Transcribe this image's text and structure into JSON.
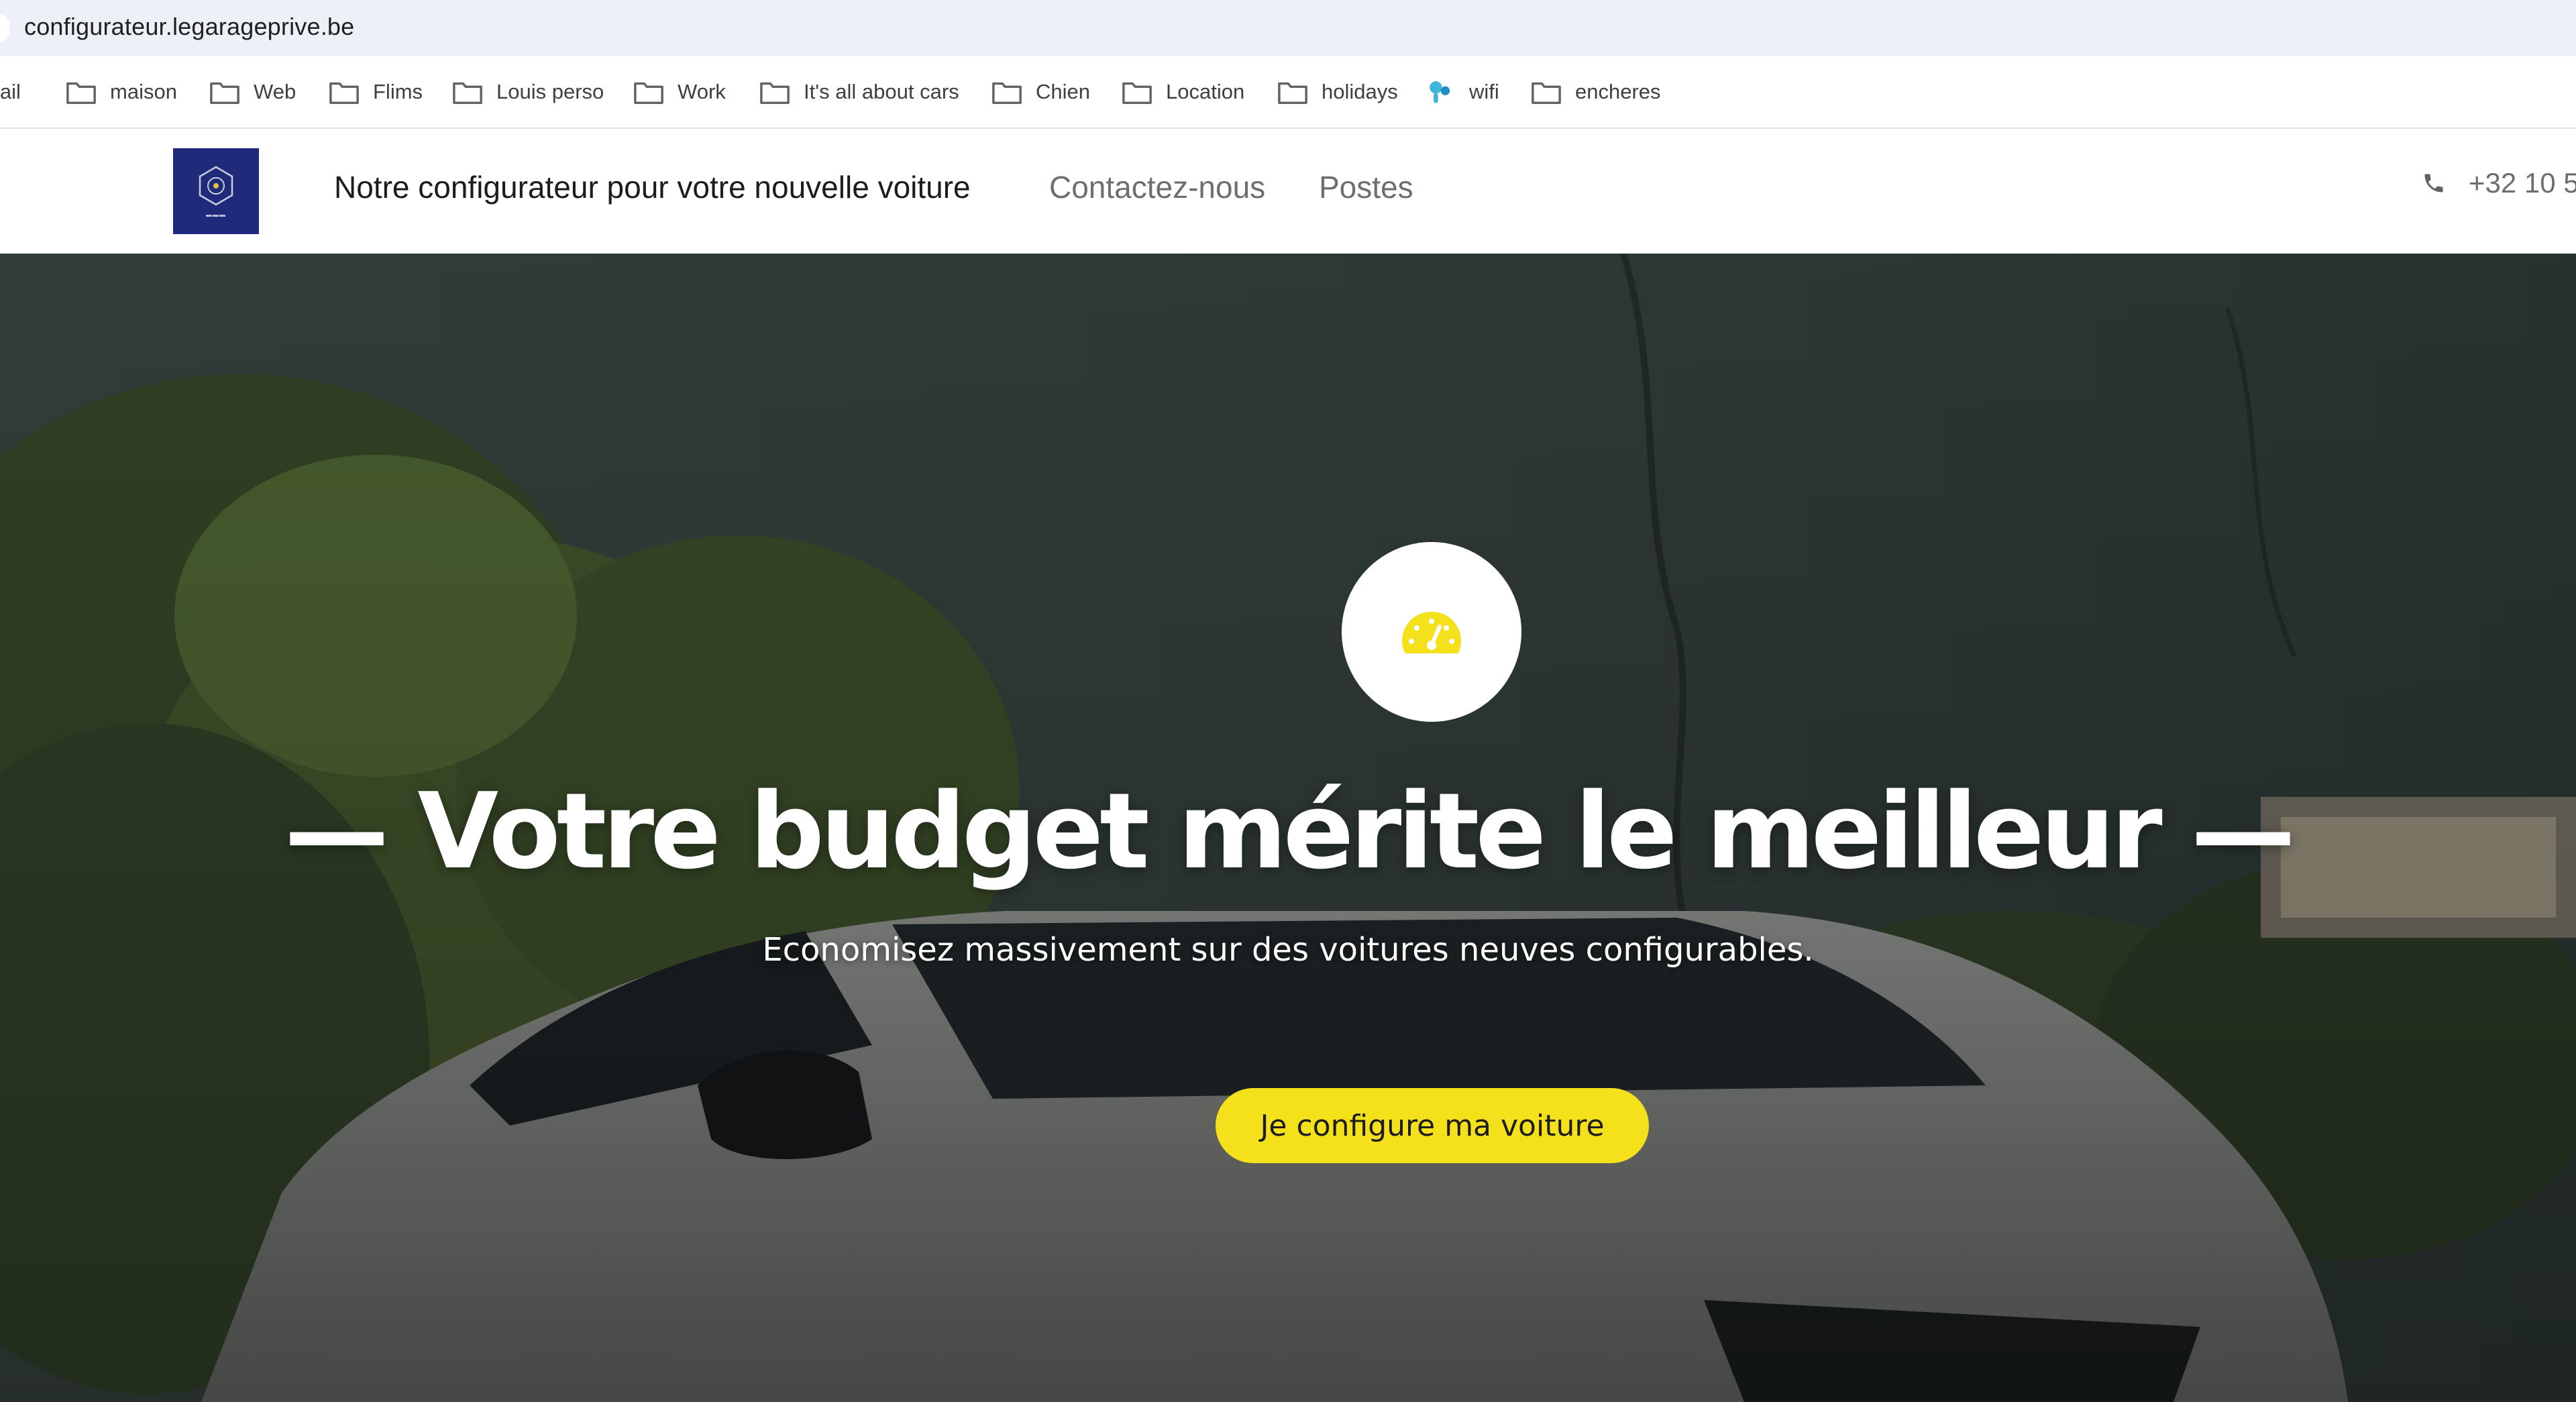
{
  "browser": {
    "url": "configurateur.legarageprive.be"
  },
  "bookmarks": [
    {
      "label": "mail",
      "icon": "folder-icon"
    },
    {
      "label": "maison",
      "icon": "folder-icon"
    },
    {
      "label": "Web",
      "icon": "folder-icon"
    },
    {
      "label": "Flims",
      "icon": "folder-icon"
    },
    {
      "label": "Louis perso",
      "icon": "folder-icon"
    },
    {
      "label": "Work",
      "icon": "folder-icon"
    },
    {
      "label": "It's all about cars",
      "icon": "folder-icon"
    },
    {
      "label": "Chien",
      "icon": "folder-icon"
    },
    {
      "label": "Location",
      "icon": "folder-icon"
    },
    {
      "label": "holidays",
      "icon": "folder-icon"
    },
    {
      "label": "wifi",
      "icon": "wifi-brand-icon"
    },
    {
      "label": "encheres",
      "icon": "folder-icon"
    }
  ],
  "header": {
    "nav": [
      {
        "label": "Notre configurateur pour votre nouvelle voiture"
      },
      {
        "label": "Contactez-nous"
      },
      {
        "label": "Postes"
      }
    ],
    "phone": "+32 10 5"
  },
  "hero": {
    "icon": "speedometer-icon",
    "title": "— Votre budget mérite le meilleur —",
    "subtitle": "Economisez massivement sur des voitures neuves configurables.",
    "cta_label": "Je configure ma voiture"
  },
  "colors": {
    "accent": "#f4e01b",
    "logo_background": "#1f2a7a",
    "addressbar": "#eef0f7"
  }
}
